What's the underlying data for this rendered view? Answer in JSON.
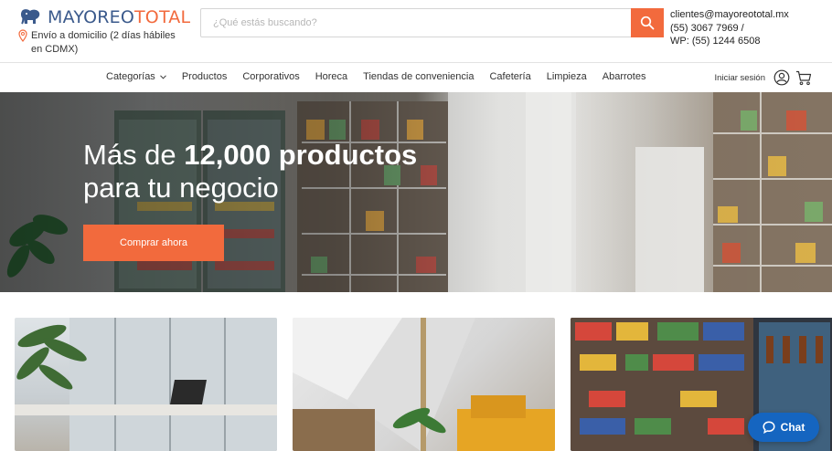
{
  "brand": {
    "name_part1": "MAYOREO",
    "name_part2": "TOTAL",
    "primary_color": "#3b5a8c",
    "accent_color": "#f26a3d"
  },
  "header": {
    "delivery_text": "Envío a domicilio (2 días hábiles en CDMX)",
    "search_placeholder": "¿Qué estás buscando?",
    "search_value": "",
    "contact": {
      "email": "clientes@mayoreototal.mx",
      "phone": "(55) 3067 7969 /",
      "whatsapp": "WP: (55) 1244 6508"
    }
  },
  "nav": {
    "items": [
      {
        "label": "Categorías",
        "has_dropdown": true
      },
      {
        "label": "Productos"
      },
      {
        "label": "Corporativos"
      },
      {
        "label": "Horeca"
      },
      {
        "label": "Tiendas de conveniencia"
      },
      {
        "label": "Cafetería"
      },
      {
        "label": "Limpieza"
      },
      {
        "label": "Abarrotes"
      }
    ],
    "login_label": "Iniciar sesión"
  },
  "hero": {
    "title_light": "Más de ",
    "title_bold": "12,000 productos",
    "title_line2": "para tu negocio",
    "cta_label": "Comprar ahora"
  },
  "chat": {
    "label": "Chat",
    "color": "#1565c0"
  }
}
